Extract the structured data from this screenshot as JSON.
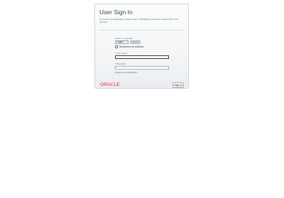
{
  "header": {
    "title": "User Sign In",
    "subtitle": "To access this application, please sign in. Mandatory fields are marked with a red asterisk."
  },
  "language": {
    "label": "Select a Language",
    "selected": "English",
    "refresh_label": "Refresh"
  },
  "remember": {
    "label": "Remember my selection"
  },
  "user_field": {
    "required_marker": "*",
    "label": "User Name",
    "value": ""
  },
  "password_field": {
    "required_marker": "*",
    "label": "Password",
    "value": ""
  },
  "forgot_link": "Forgot your password?",
  "brand": {
    "logo_text": "ORACLE",
    "color": "#e3272d"
  },
  "signin_button": {
    "label": "Sign In"
  }
}
